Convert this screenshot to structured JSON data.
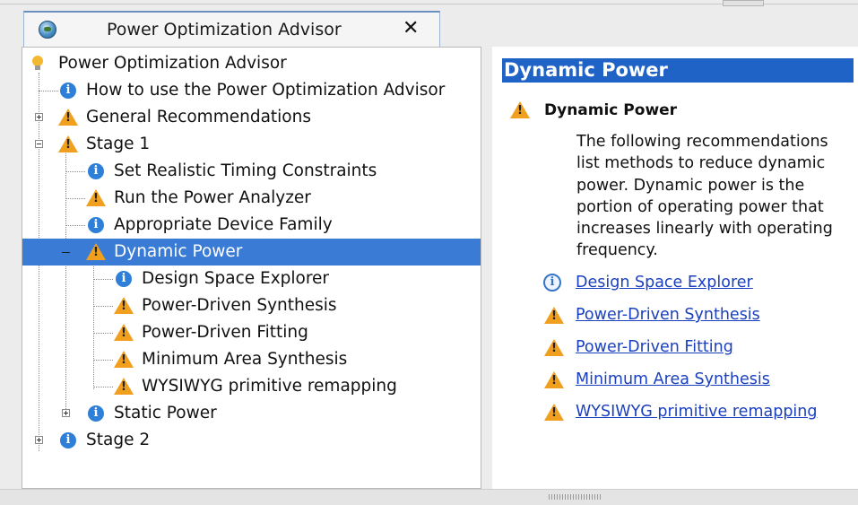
{
  "tab": {
    "title": "Power Optimization Advisor",
    "close_label": "✕"
  },
  "tree": {
    "root": "Power Optimization Advisor",
    "items": [
      {
        "label": "How to use the Power Optimization Advisor",
        "icon": "info-icon"
      },
      {
        "label": "General Recommendations",
        "icon": "warning-icon",
        "expander": "+"
      },
      {
        "label": "Stage 1",
        "icon": "warning-icon",
        "expander": "-"
      },
      {
        "label": "Set Realistic Timing Constraints",
        "icon": "info-icon"
      },
      {
        "label": "Run the Power Analyzer",
        "icon": "warning-icon"
      },
      {
        "label": "Appropriate Device Family",
        "icon": "info-icon"
      },
      {
        "label": "Dynamic Power",
        "icon": "warning-icon",
        "expander": "-",
        "selected": true
      },
      {
        "label": "Design Space Explorer",
        "icon": "info-icon"
      },
      {
        "label": "Power-Driven Synthesis",
        "icon": "warning-icon"
      },
      {
        "label": "Power-Driven Fitting",
        "icon": "warning-icon"
      },
      {
        "label": "Minimum Area Synthesis",
        "icon": "warning-icon"
      },
      {
        "label": "WYSIWYG primitive remapping",
        "icon": "warning-icon"
      },
      {
        "label": "Static Power",
        "icon": "info-icon",
        "expander": "+"
      },
      {
        "label": "Stage 2",
        "icon": "info-icon",
        "expander": "+"
      }
    ]
  },
  "detail": {
    "header": "Dynamic Power",
    "section_title": "Dynamic Power",
    "description_lines": [
      "The following recommendations",
      "list methods to reduce dynamic",
      "power. Dynamic power is the",
      "portion of operating power that",
      "increases linearly with operating",
      "frequency."
    ],
    "links": [
      {
        "label": "Design Space Explorer",
        "icon": "info-icon"
      },
      {
        "label": "Power-Driven Synthesis",
        "icon": "warning-icon"
      },
      {
        "label": "Power-Driven Fitting",
        "icon": "warning-icon"
      },
      {
        "label": "Minimum Area Synthesis",
        "icon": "warning-icon"
      },
      {
        "label": "WYSIWYG primitive remapping",
        "icon": "warning-icon"
      }
    ]
  },
  "colors": {
    "selection": "#3a7bd5",
    "header": "#1f63c6",
    "link": "#1a3fbf",
    "warning": "#f0a01e",
    "info": "#2e7fd8"
  }
}
